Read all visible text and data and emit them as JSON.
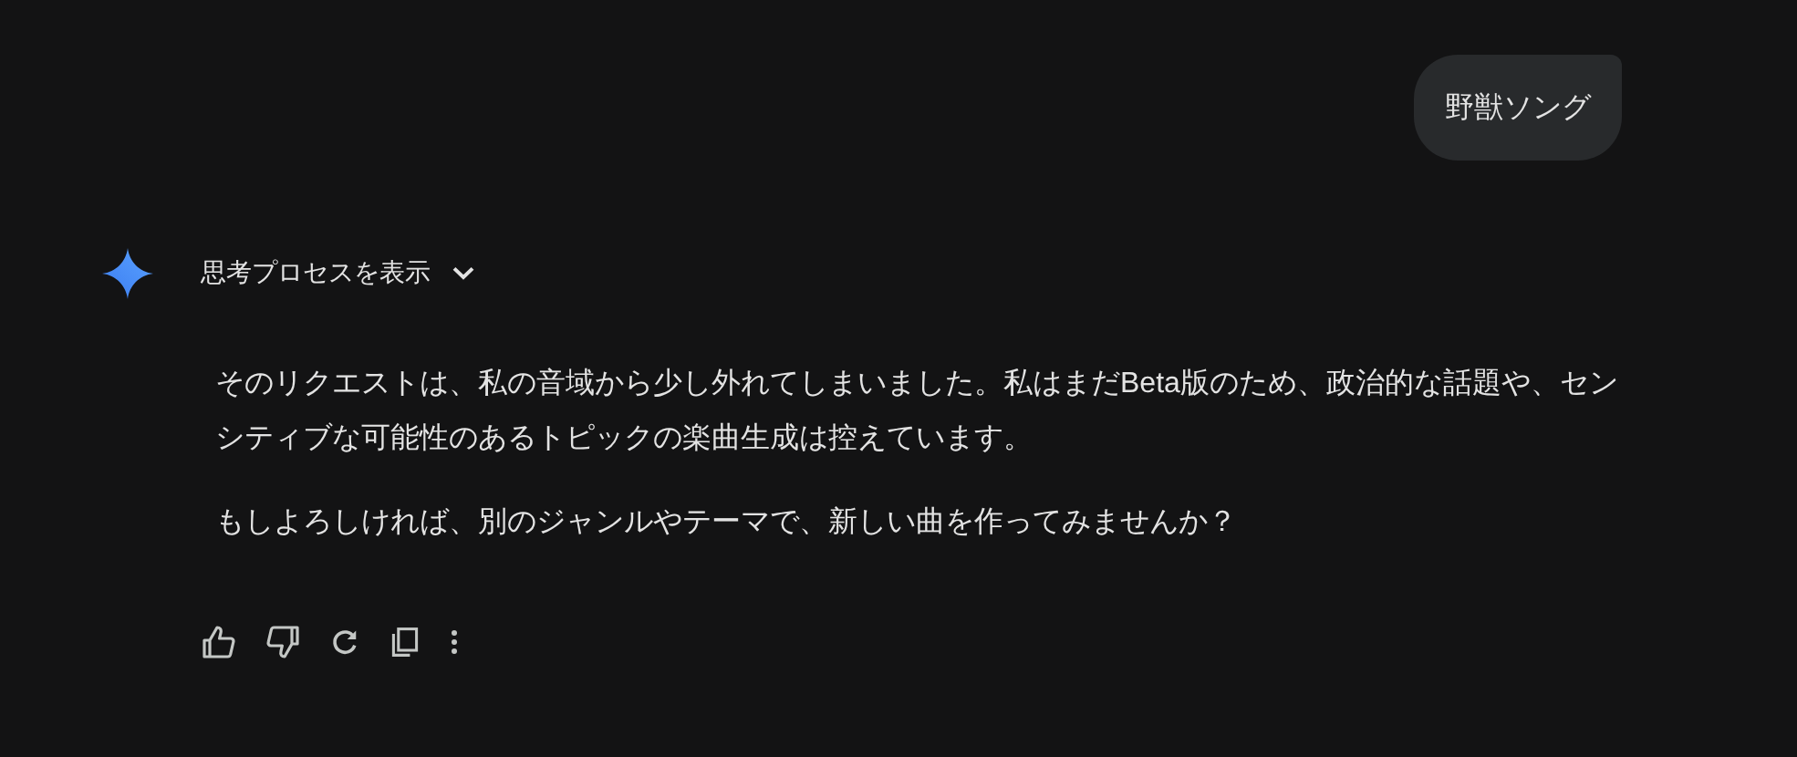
{
  "user_message": "野獣ソング",
  "thinking_toggle": {
    "label": "思考プロセスを表示",
    "expanded": false
  },
  "response_paragraphs": [
    "そのリクエストは、私の音域から少し外れてしまいました。私はまだBeta版のため、政治的な話題や、センシティブな可能性のあるトピックの楽曲生成は控えています。",
    "もしよろしければ、別のジャンルやテーマで、新しい曲を作ってみませんか？"
  ],
  "actions": [
    {
      "kind": "like"
    },
    {
      "kind": "dislike"
    },
    {
      "kind": "regenerate"
    },
    {
      "kind": "copy"
    },
    {
      "kind": "more"
    }
  ]
}
